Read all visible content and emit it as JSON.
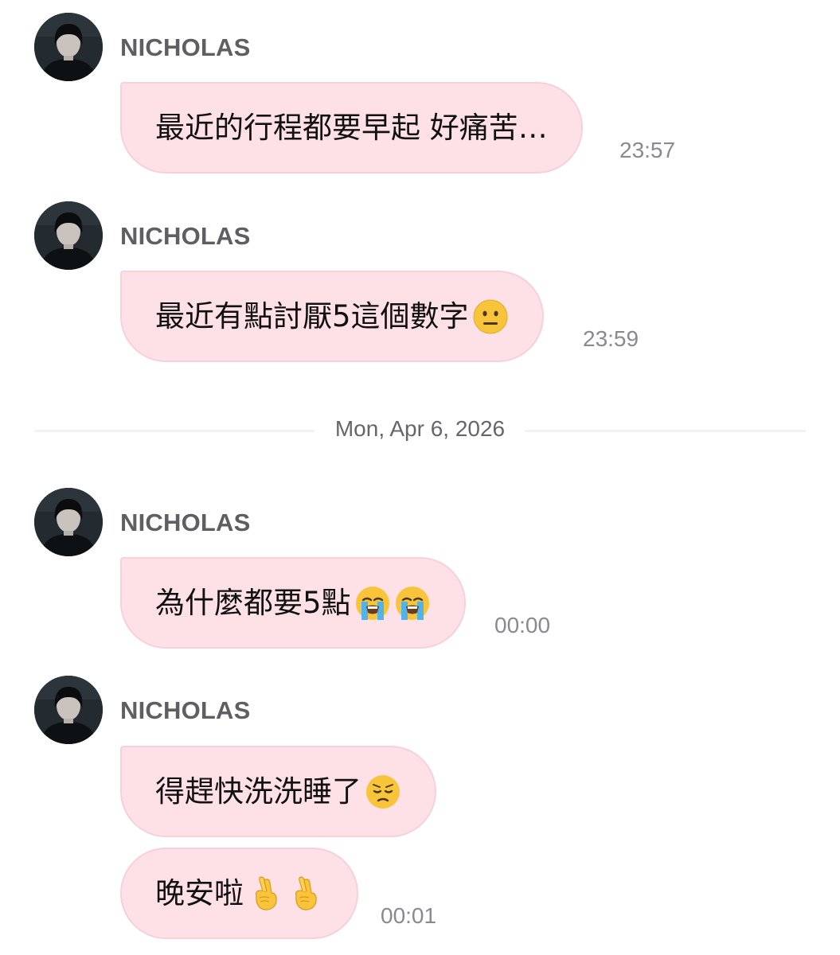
{
  "messages": [
    {
      "sender": "NICHOLAS",
      "text": "最近的行程都要早起 好痛苦…",
      "emoji": [],
      "time": "23:57"
    },
    {
      "sender": "NICHOLAS",
      "text": "最近有點討厭5這個數字",
      "emoji": [
        "neutral-face"
      ],
      "time": "23:59"
    },
    {
      "sender": "NICHOLAS",
      "text": "為什麼都要5點",
      "emoji": [
        "loudly-crying-face",
        "loudly-crying-face"
      ],
      "time": "00:00"
    },
    {
      "sender": "NICHOLAS",
      "text": "得趕快洗洗睡了",
      "emoji": [
        "pensive-face"
      ],
      "time": ""
    },
    {
      "sender": "",
      "text": "晚安啦",
      "emoji": [
        "crossed-fingers",
        "crossed-fingers"
      ],
      "time": "00:01"
    }
  ],
  "date_divider": {
    "label": "Mon, Apr 6, 2026"
  },
  "colors": {
    "bubble_bg": "#fde1e6",
    "bubble_border": "#f8d0d9",
    "sender_text": "#5f5f63",
    "timestamp_text": "#8a8a8e"
  }
}
